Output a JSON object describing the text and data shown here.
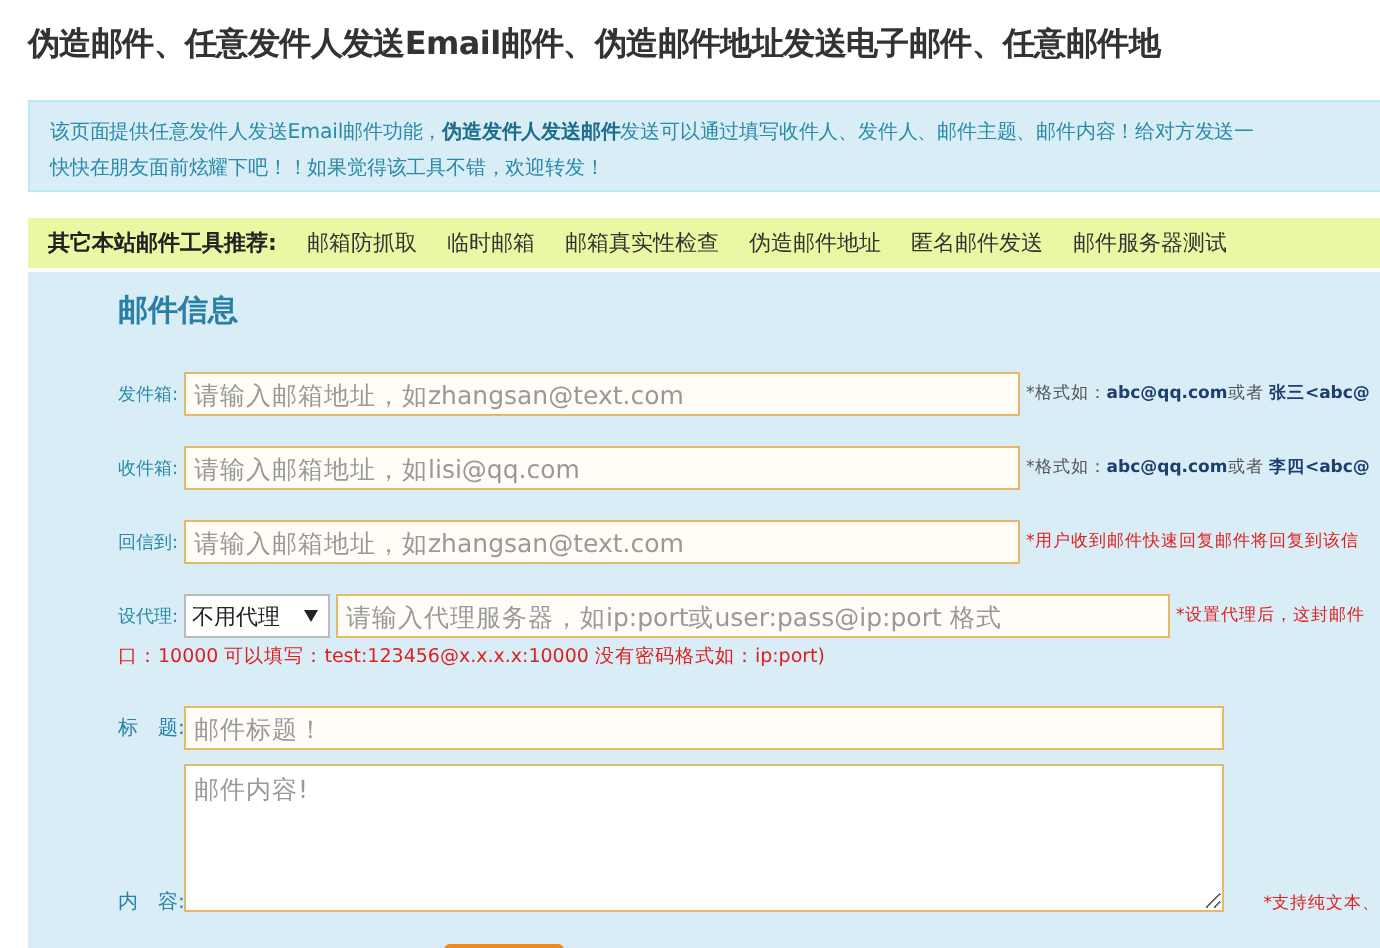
{
  "page_title": "伪造邮件、任意发件人发送Email邮件、伪造邮件地址发送电子邮件、任意邮件地",
  "intro": {
    "lines": [
      "该页面提供任意发件人发送Email邮件功能，**伪造发件人发送邮件**发送可以通过填写收件人、发件人、邮件主题、邮件内容！给对方发送一",
      "快快在朋友面前炫耀下吧！！如果觉得该工具不错，欢迎转发！"
    ]
  },
  "tools_bar": {
    "label": "其它本站邮件工具推荐:",
    "links": [
      "邮箱防抓取",
      "临时邮箱",
      "邮箱真实性检查",
      "伪造邮件地址",
      "匿名邮件发送",
      "邮件服务器测试"
    ]
  },
  "form": {
    "heading": "邮件信息",
    "fields": [
      {
        "kind": "text",
        "label": "发件箱:",
        "placeholder": "请输入邮箱地址，如zhangsan@text.com",
        "hint": "*格式如：**abc@qq.com**或者 **张三<abc@**",
        "hint_warning": false
      },
      {
        "kind": "text",
        "label": "收件箱:",
        "placeholder": "请输入邮箱地址，如lisi@qq.com",
        "hint": "*格式如：**abc@qq.com**或者 **李四<abc@**",
        "hint_warning": false
      },
      {
        "kind": "text",
        "label": "回信到:",
        "placeholder": "请输入邮箱地址，如zhangsan@text.com",
        "hint": "*用户收到邮件快速回复邮件将回复到该信",
        "hint_warning": true
      },
      {
        "kind": "proxy",
        "label": "设代理:",
        "select_value": "不用代理",
        "placeholder": "请输入代理服务器，如ip:port或user:pass@ip:port 格式",
        "hint": "*设置代理后，这封邮件",
        "hint_warning": true,
        "note": "口：10000 可以填写：test:123456@x.x.x.x:10000 没有密码格式如：ip:port)"
      },
      {
        "kind": "subject",
        "label": "标　题:",
        "placeholder": "邮件标题！"
      },
      {
        "kind": "textarea",
        "label": "内　容:",
        "placeholder": "邮件内容!",
        "hint": "*支持纯文本、",
        "hint_warning": true
      }
    ]
  }
}
